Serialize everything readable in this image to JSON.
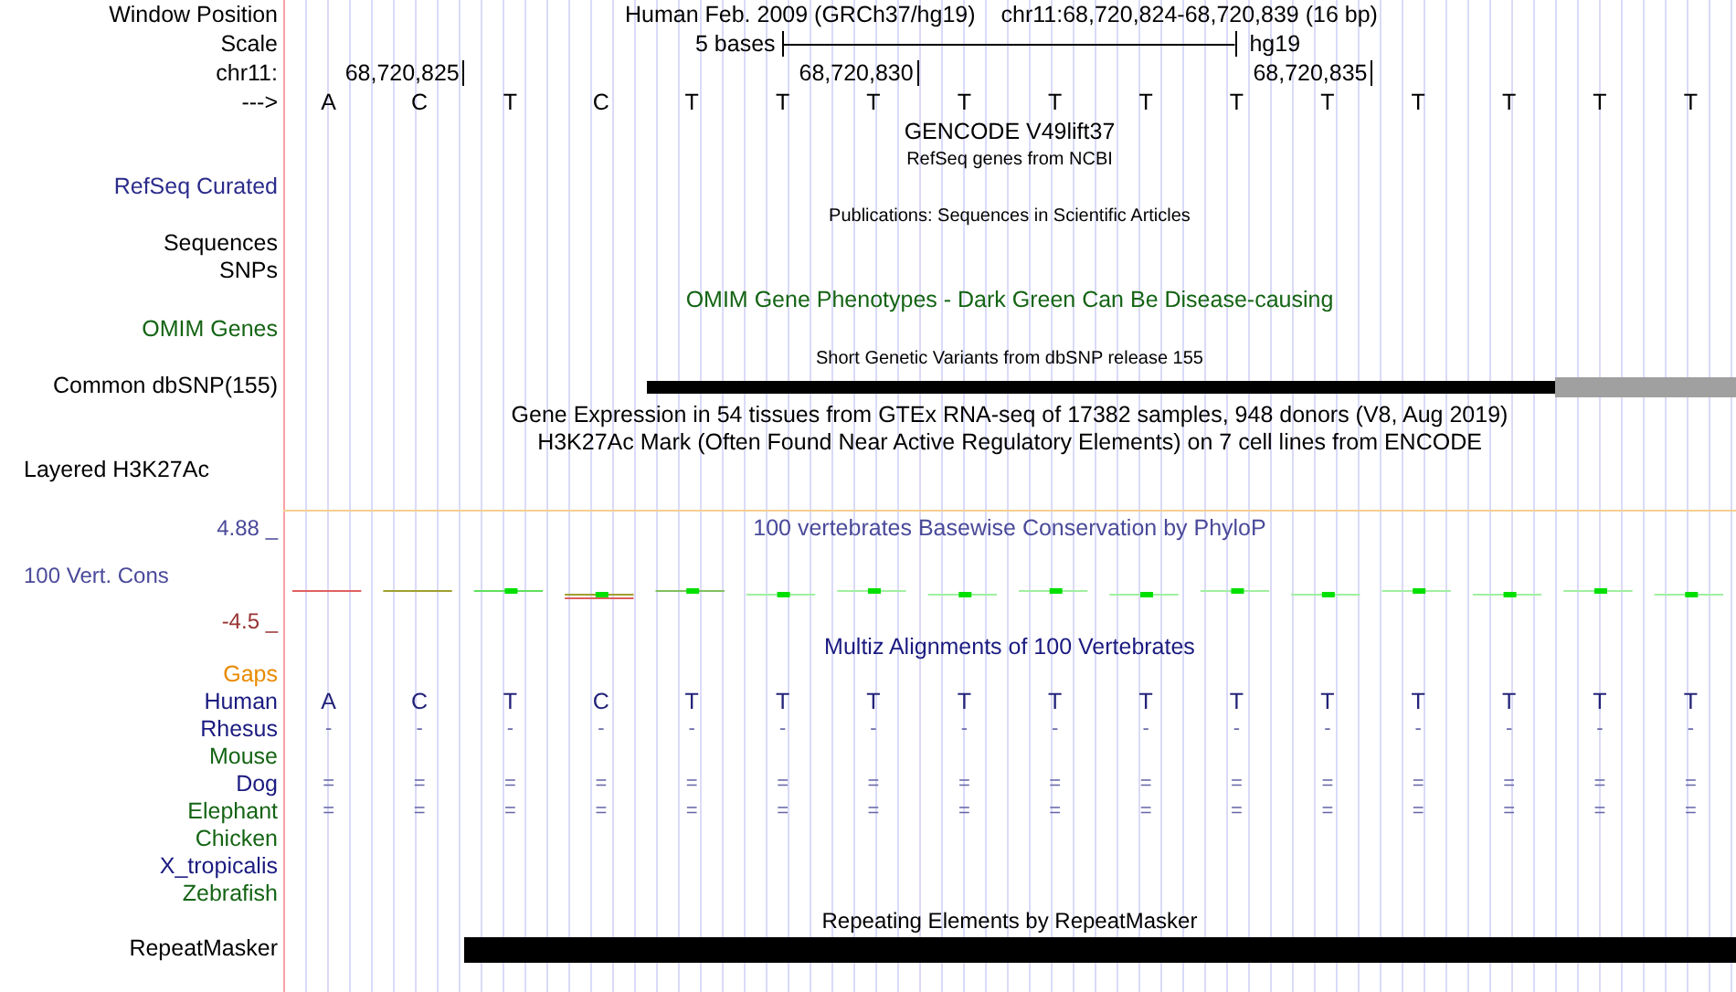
{
  "rows": [
    {
      "kind": "position",
      "label": "Window Position",
      "assembly": "Human Feb. 2009 (GRCh37/hg19)",
      "position": "chr11:68,720,824-68,720,839 (16 bp)"
    },
    {
      "kind": "scale",
      "label": "Scale",
      "length": "5 bases",
      "assembly": "hg19"
    },
    {
      "kind": "ruler",
      "label": "chr11:",
      "ticks": [
        "68,720,825",
        "68,720,830",
        "68,720,835"
      ]
    },
    {
      "kind": "bases",
      "label": "--->",
      "bases": [
        "A",
        "C",
        "T",
        "C",
        "T",
        "T",
        "T",
        "T",
        "T",
        "T",
        "T",
        "T",
        "T",
        "T",
        "T",
        "T"
      ]
    },
    {
      "kind": "title",
      "text": "GENCODE V49lift37",
      "color": "#000000"
    },
    {
      "kind": "subtitle",
      "text": "RefSeq genes from NCBI"
    },
    {
      "kind": "label",
      "label": "RefSeq Curated",
      "color": "#2b2b8c"
    },
    {
      "kind": "subtitle",
      "text": "Publications: Sequences in Scientific Articles"
    },
    {
      "kind": "label",
      "label": "Sequences",
      "color": "#000000"
    },
    {
      "kind": "label",
      "label": "SNPs",
      "color": "#000000"
    },
    {
      "kind": "title",
      "text": "OMIM Gene Phenotypes - Dark Green Can Be Disease-causing",
      "color": "#146414"
    },
    {
      "kind": "label",
      "label": "OMIM Genes",
      "color": "#146414"
    },
    {
      "kind": "subtitle",
      "text": "Short Genetic Variants from dbSNP release 155"
    },
    {
      "kind": "snp-track",
      "label": "Common dbSNP(155)"
    },
    {
      "kind": "title",
      "text": "Gene Expression in 54 tissues from GTEx RNA-seq of 17382 samples, 948 donors (V8, Aug 2019)",
      "color": "#000000"
    },
    {
      "kind": "title",
      "text": "H3K27Ac Mark (Often Found Near Active Regulatory Elements) on 7 cell lines from ENCODE",
      "color": "#000000"
    },
    {
      "kind": "side-label",
      "label": "Layered H3K27Ac"
    },
    {
      "kind": "separator"
    },
    {
      "kind": "wiggle",
      "upper": "4.88 _",
      "label": "100 Vert. Cons",
      "lower": "-4.5 _",
      "title": "100 vertebrates Basewise Conservation by PhyloP"
    },
    {
      "kind": "title",
      "text": "Multiz Alignments of 100 Vertebrates",
      "color": "#1a1a80"
    },
    {
      "kind": "species",
      "label": "Gaps",
      "color": "#e88a00"
    },
    {
      "kind": "species",
      "label": "Human",
      "color": "#1a1a80",
      "cells": [
        "A",
        "C",
        "T",
        "C",
        "T",
        "T",
        "T",
        "T",
        "T",
        "T",
        "T",
        "T",
        "T",
        "T",
        "T",
        "T"
      ]
    },
    {
      "kind": "species",
      "label": "Rhesus",
      "color": "#1a1a80",
      "cells": [
        "-",
        "-",
        "-",
        "-",
        "-",
        "-",
        "-",
        "-",
        "-",
        "-",
        "-",
        "-",
        "-",
        "-",
        "-",
        "-"
      ]
    },
    {
      "kind": "species",
      "label": "Mouse",
      "color": "#146414"
    },
    {
      "kind": "species",
      "label": "Dog",
      "color": "#1a1a80",
      "cells": [
        "=",
        "=",
        "=",
        "=",
        "=",
        "=",
        "=",
        "=",
        "=",
        "=",
        "=",
        "=",
        "=",
        "=",
        "=",
        "="
      ]
    },
    {
      "kind": "species",
      "label": "Elephant",
      "color": "#146414",
      "cells": [
        "=",
        "=",
        "=",
        "=",
        "=",
        "=",
        "=",
        "=",
        "=",
        "=",
        "=",
        "=",
        "=",
        "=",
        "=",
        "="
      ]
    },
    {
      "kind": "species",
      "label": "Chicken",
      "color": "#146414"
    },
    {
      "kind": "species",
      "label": "X_tropicalis",
      "color": "#1a1a80"
    },
    {
      "kind": "species",
      "label": "Zebrafish",
      "color": "#146414"
    },
    {
      "kind": "mid-title",
      "text": "Repeating Elements by RepeatMasker"
    },
    {
      "kind": "repeat-track",
      "label": "RepeatMasker"
    }
  ]
}
